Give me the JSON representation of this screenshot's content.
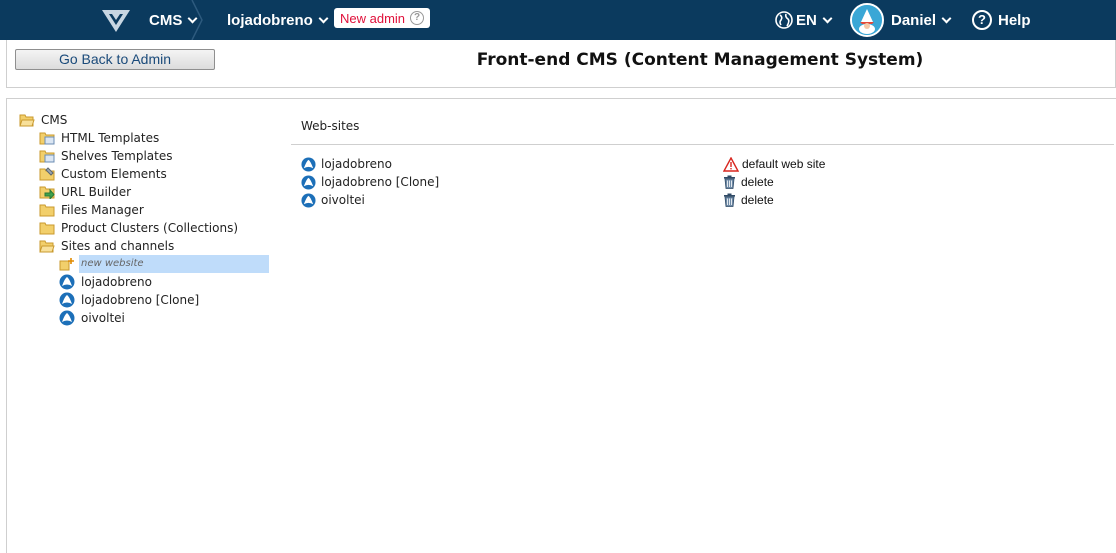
{
  "topbar": {
    "app_menu": "CMS",
    "store_menu": "lojadobreno",
    "new_admin_label": "New admin",
    "language": "EN",
    "user_name": "Daniel",
    "help_label": "Help"
  },
  "header": {
    "back_button": "Go Back to Admin",
    "title": "Front-end CMS (Content Management System)"
  },
  "tree": {
    "root": "CMS",
    "items": [
      {
        "label": "HTML Templates",
        "icon": "html-templates-icon"
      },
      {
        "label": "Shelves Templates",
        "icon": "shelves-templates-icon"
      },
      {
        "label": "Custom Elements",
        "icon": "custom-elements-icon"
      },
      {
        "label": "URL Builder",
        "icon": "url-builder-icon"
      },
      {
        "label": "Files Manager",
        "icon": "folder-icon"
      },
      {
        "label": "Product Clusters (Collections)",
        "icon": "folder-icon"
      },
      {
        "label": "Sites and channels",
        "icon": "folder-open-icon"
      }
    ],
    "new_website": "new website",
    "sites": [
      "lojadobreno",
      "lojadobreno [Clone]",
      "oivoltei"
    ]
  },
  "main": {
    "section_title": "Web-sites",
    "sites": [
      {
        "name": "lojadobreno",
        "action": "default web site",
        "action_icon": "warning-icon"
      },
      {
        "name": "lojadobreno [Clone]",
        "action": "delete",
        "action_icon": "trash-icon"
      },
      {
        "name": "oivoltei",
        "action": "delete",
        "action_icon": "trash-icon"
      }
    ]
  },
  "colors": {
    "topbar": "#0b3a5e",
    "new_admin_text": "#e0103a",
    "selection": "#bfdcfa"
  }
}
